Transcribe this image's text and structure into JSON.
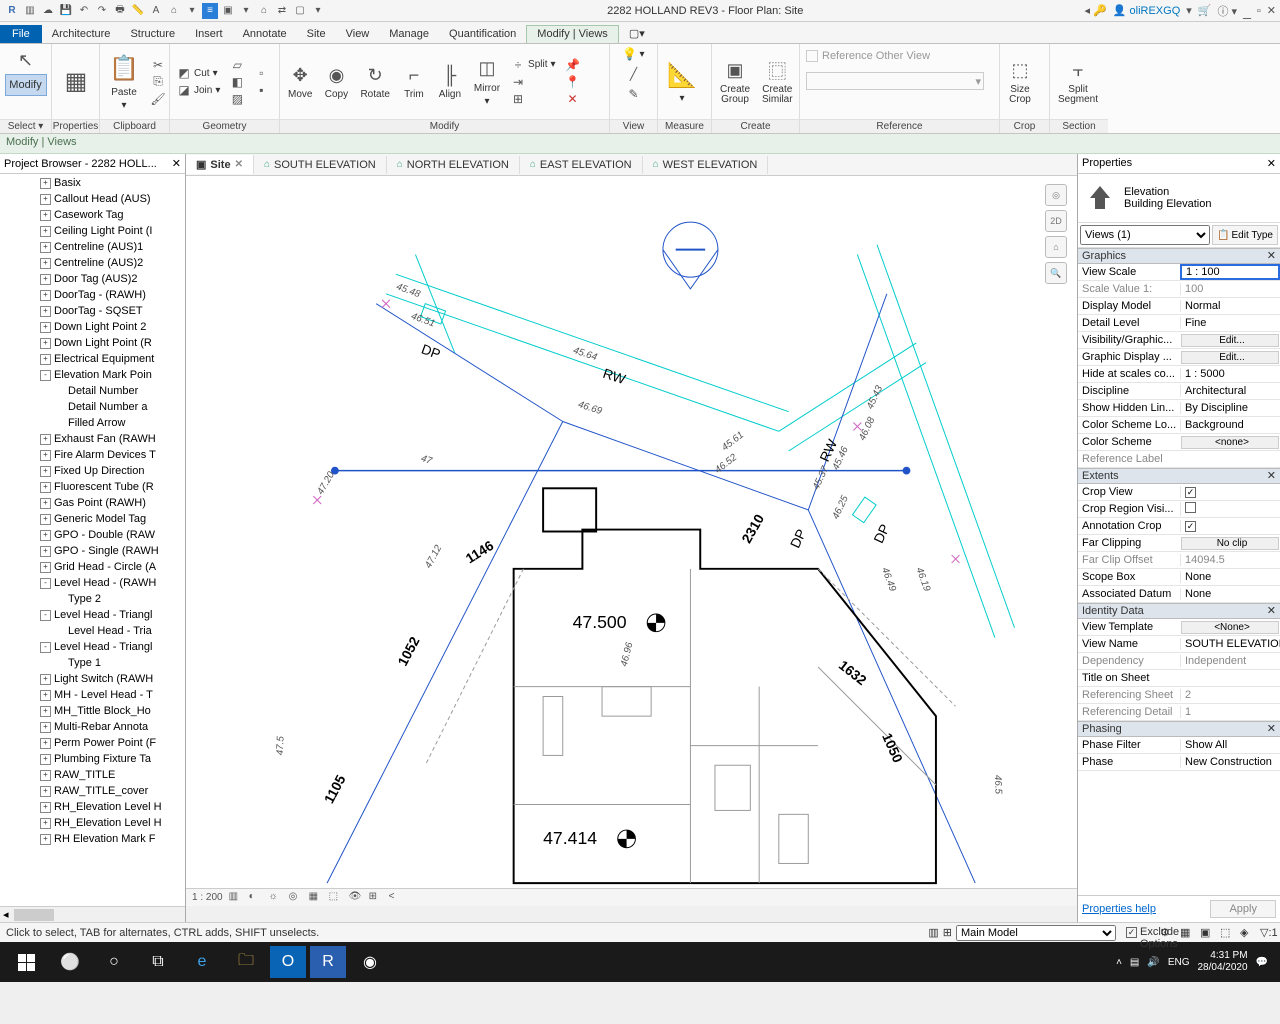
{
  "title_bar": {
    "title": "2282 HOLLAND REV3 - Floor Plan: Site",
    "user": "oliREXGQ"
  },
  "menu": {
    "file": "File",
    "tabs": [
      "Architecture",
      "Structure",
      "Insert",
      "Annotate",
      "Site",
      "View",
      "Manage",
      "Quantification"
    ],
    "active": "Modify | Views"
  },
  "ribbon": {
    "select": {
      "modify": "Modify",
      "select": "Select",
      "properties": "Properties"
    },
    "clipboard": {
      "paste": "Paste",
      "cut": "Cut",
      "join": "Join",
      "label": "Clipboard"
    },
    "geometry": {
      "label": "Geometry"
    },
    "modify": {
      "move": "Move",
      "copy": "Copy",
      "rotate": "Rotate",
      "trim": "Trim",
      "align": "Align",
      "mirror": "Mirror",
      "split": "Split",
      "label": "Modify"
    },
    "view": {
      "label": "View"
    },
    "measure": {
      "label": "Measure"
    },
    "create": {
      "group": "Create\nGroup",
      "similar": "Create\nSimilar",
      "label": "Create"
    },
    "reference": {
      "check": "Reference Other View",
      "label": "Reference"
    },
    "crop": {
      "size": "Size\nCrop",
      "split": "Split\nSegment",
      "c1": "Crop",
      "c2": "Section"
    }
  },
  "context_bar": "Modify | Views",
  "project_browser": {
    "title": "Project Browser - 2282 HOLL...",
    "items": [
      {
        "exp": "+",
        "ind": 2,
        "label": "Basix"
      },
      {
        "exp": "+",
        "ind": 2,
        "label": "Callout Head (AUS)"
      },
      {
        "exp": "+",
        "ind": 2,
        "label": "Casework Tag"
      },
      {
        "exp": "+",
        "ind": 2,
        "label": "Ceiling Light Point (I"
      },
      {
        "exp": "+",
        "ind": 2,
        "label": "Centreline (AUS)1"
      },
      {
        "exp": "+",
        "ind": 2,
        "label": "Centreline (AUS)2"
      },
      {
        "exp": "+",
        "ind": 2,
        "label": "Door Tag (AUS)2"
      },
      {
        "exp": "+",
        "ind": 2,
        "label": "DoorTag - (RAWH)"
      },
      {
        "exp": "+",
        "ind": 2,
        "label": "DoorTag - SQSET"
      },
      {
        "exp": "+",
        "ind": 2,
        "label": "Down Light Point 2"
      },
      {
        "exp": "+",
        "ind": 2,
        "label": "Down Light Point (R"
      },
      {
        "exp": "+",
        "ind": 2,
        "label": "Electrical Equipment"
      },
      {
        "exp": "-",
        "ind": 2,
        "label": "Elevation Mark Poin"
      },
      {
        "exp": "",
        "ind": 3,
        "label": "Detail Number"
      },
      {
        "exp": "",
        "ind": 3,
        "label": "Detail Number a"
      },
      {
        "exp": "",
        "ind": 3,
        "label": "Filled Arrow"
      },
      {
        "exp": "+",
        "ind": 2,
        "label": "Exhaust Fan (RAWH"
      },
      {
        "exp": "+",
        "ind": 2,
        "label": "Fire Alarm Devices T"
      },
      {
        "exp": "+",
        "ind": 2,
        "label": "Fixed Up Direction"
      },
      {
        "exp": "+",
        "ind": 2,
        "label": "Fluorescent Tube (R"
      },
      {
        "exp": "+",
        "ind": 2,
        "label": "Gas Point (RAWH)"
      },
      {
        "exp": "+",
        "ind": 2,
        "label": "Generic Model Tag"
      },
      {
        "exp": "+",
        "ind": 2,
        "label": "GPO - Double (RAW"
      },
      {
        "exp": "+",
        "ind": 2,
        "label": "GPO - Single (RAWH"
      },
      {
        "exp": "+",
        "ind": 2,
        "label": "Grid Head - Circle (A"
      },
      {
        "exp": "-",
        "ind": 2,
        "label": "Level Head - (RAWH"
      },
      {
        "exp": "",
        "ind": 3,
        "label": "Type 2"
      },
      {
        "exp": "-",
        "ind": 2,
        "label": "Level Head - Triangl"
      },
      {
        "exp": "",
        "ind": 3,
        "label": "Level Head - Tria"
      },
      {
        "exp": "-",
        "ind": 2,
        "label": "Level Head - Triangl"
      },
      {
        "exp": "",
        "ind": 3,
        "label": "Type 1"
      },
      {
        "exp": "+",
        "ind": 2,
        "label": "Light Switch (RAWH"
      },
      {
        "exp": "+",
        "ind": 2,
        "label": "MH - Level Head - T"
      },
      {
        "exp": "+",
        "ind": 2,
        "label": "MH_Tittle Block_Ho"
      },
      {
        "exp": "+",
        "ind": 2,
        "label": "Multi-Rebar Annota"
      },
      {
        "exp": "+",
        "ind": 2,
        "label": "Perm Power Point (F"
      },
      {
        "exp": "+",
        "ind": 2,
        "label": "Plumbing Fixture Ta"
      },
      {
        "exp": "+",
        "ind": 2,
        "label": "RAW_TITLE"
      },
      {
        "exp": "+",
        "ind": 2,
        "label": "RAW_TITLE_cover"
      },
      {
        "exp": "+",
        "ind": 2,
        "label": "RH_Elevation Level H"
      },
      {
        "exp": "+",
        "ind": 2,
        "label": "RH_Elevation Level H"
      },
      {
        "exp": "+",
        "ind": 2,
        "label": "RH Elevation Mark F"
      }
    ]
  },
  "view_tabs": [
    {
      "label": "Site",
      "active": true,
      "home": true
    },
    {
      "label": "SOUTH ELEVATION",
      "active": false,
      "home": true
    },
    {
      "label": "NORTH ELEVATION",
      "active": false,
      "home": true
    },
    {
      "label": "EAST ELEVATION",
      "active": false,
      "home": true
    },
    {
      "label": "WEST ELEVATION",
      "active": false,
      "home": true
    }
  ],
  "view_control": {
    "scale": "1 : 200"
  },
  "canvas": {
    "labels": {
      "dp1": "DP",
      "dp2": "DP",
      "dp3": "DP",
      "rw1": "RW",
      "rw2": "RW",
      "spot1": "47.500",
      "spot2": "47.414",
      "d1": "1146",
      "d2": "1052",
      "d3": "1105",
      "d4": "1632",
      "d5": "1050",
      "d6": "2310",
      "c1": "45.48",
      "c2": "46.51",
      "c3": "45.64",
      "c4": "46.69",
      "c5": "45.61",
      "c6": "46.52",
      "c7": "45.37",
      "c8": "46.25",
      "c9": "45.46",
      "c10": "46.08",
      "c11": "45.43",
      "c12": "46.49",
      "c13": "46.19",
      "c14": "47",
      "c15": "47.20",
      "c16": "47.12",
      "c17": "47.5",
      "c18": "46.5",
      "c19": "46.96"
    }
  },
  "properties": {
    "title": "Properties",
    "type_name": "Elevation",
    "type_sub": "Building Elevation",
    "selector": "Views (1)",
    "edit_type": "Edit Type",
    "groups": {
      "graphics": "Graphics",
      "extents": "Extents",
      "identity": "Identity Data",
      "phasing": "Phasing"
    },
    "rows": {
      "view_scale": {
        "n": "View Scale",
        "v": "1 : 100"
      },
      "scale_value": {
        "n": "Scale Value   1:",
        "v": "100"
      },
      "display_model": {
        "n": "Display Model",
        "v": "Normal"
      },
      "detail_level": {
        "n": "Detail Level",
        "v": "Fine"
      },
      "vis_graphics": {
        "n": "Visibility/Graphic...",
        "v": "Edit..."
      },
      "graphic_disp": {
        "n": "Graphic Display ...",
        "v": "Edit..."
      },
      "hide_scales": {
        "n": "Hide at scales co...",
        "v": "1 : 5000"
      },
      "discipline": {
        "n": "Discipline",
        "v": "Architectural"
      },
      "show_hidden": {
        "n": "Show Hidden Lin...",
        "v": "By Discipline"
      },
      "color_loc": {
        "n": "Color Scheme Lo...",
        "v": "Background"
      },
      "color_scheme": {
        "n": "Color Scheme",
        "v": "<none>"
      },
      "ref_label": {
        "n": "Reference Label",
        "v": ""
      },
      "crop_view": {
        "n": "Crop View",
        "v": "✓"
      },
      "crop_region": {
        "n": "Crop Region Visi...",
        "v": ""
      },
      "annot_crop": {
        "n": "Annotation Crop",
        "v": "✓"
      },
      "far_clip": {
        "n": "Far Clipping",
        "v": "No clip"
      },
      "far_offset": {
        "n": "Far Clip Offset",
        "v": "14094.5"
      },
      "scope_box": {
        "n": "Scope Box",
        "v": "None"
      },
      "assoc_datum": {
        "n": "Associated Datum",
        "v": "None"
      },
      "view_template": {
        "n": "View Template",
        "v": "<None>"
      },
      "view_name": {
        "n": "View Name",
        "v": "SOUTH ELEVATION"
      },
      "dependency": {
        "n": "Dependency",
        "v": "Independent"
      },
      "title_sheet": {
        "n": "Title on Sheet",
        "v": ""
      },
      "ref_sheet": {
        "n": "Referencing Sheet",
        "v": "2"
      },
      "ref_detail": {
        "n": "Referencing Detail",
        "v": "1"
      },
      "phase_filter": {
        "n": "Phase Filter",
        "v": "Show All"
      },
      "phase": {
        "n": "Phase",
        "v": "New Construction"
      }
    },
    "help": "Properties help",
    "apply": "Apply"
  },
  "status": {
    "msg": "Click to select, TAB for alternates, CTRL adds, SHIFT unselects.",
    "model": "Main Model",
    "exclude": "Exclude Options",
    "filter_count": ":1"
  },
  "taskbar": {
    "lang": "ENG",
    "time": "4:31 PM",
    "date": "28/04/2020"
  }
}
